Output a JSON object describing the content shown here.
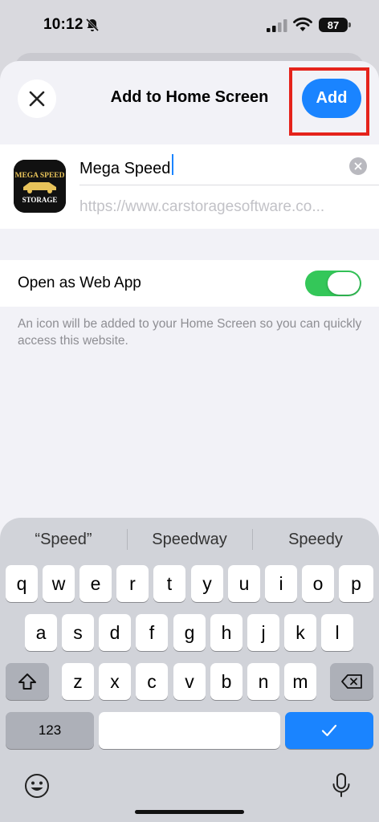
{
  "status_bar": {
    "time": "10:12",
    "battery": "87"
  },
  "nav": {
    "title": "Add to Home Screen",
    "add_label": "Add"
  },
  "shortcut": {
    "name_value": "Mega Speed",
    "url": "https://www.carstoragesoftware.co...",
    "icon_text_top": "MEGA SPEED",
    "icon_text_bottom": "STORAGE"
  },
  "web_app": {
    "label": "Open as Web App",
    "enabled": true
  },
  "footnote": "An icon will be added to your Home Screen so you can quickly access this website.",
  "keyboard": {
    "suggestions": [
      "“Speed”",
      "Speedway",
      "Speedy"
    ],
    "rows": [
      [
        "q",
        "w",
        "e",
        "r",
        "t",
        "y",
        "u",
        "i",
        "o",
        "p"
      ],
      [
        "a",
        "s",
        "d",
        "f",
        "g",
        "h",
        "j",
        "k",
        "l"
      ],
      [
        "z",
        "x",
        "c",
        "v",
        "b",
        "n",
        "m"
      ]
    ],
    "numbers_label": "123"
  },
  "colors": {
    "accent": "#1a84ff",
    "toggle_on": "#34c759",
    "highlight": "#e5231b"
  }
}
